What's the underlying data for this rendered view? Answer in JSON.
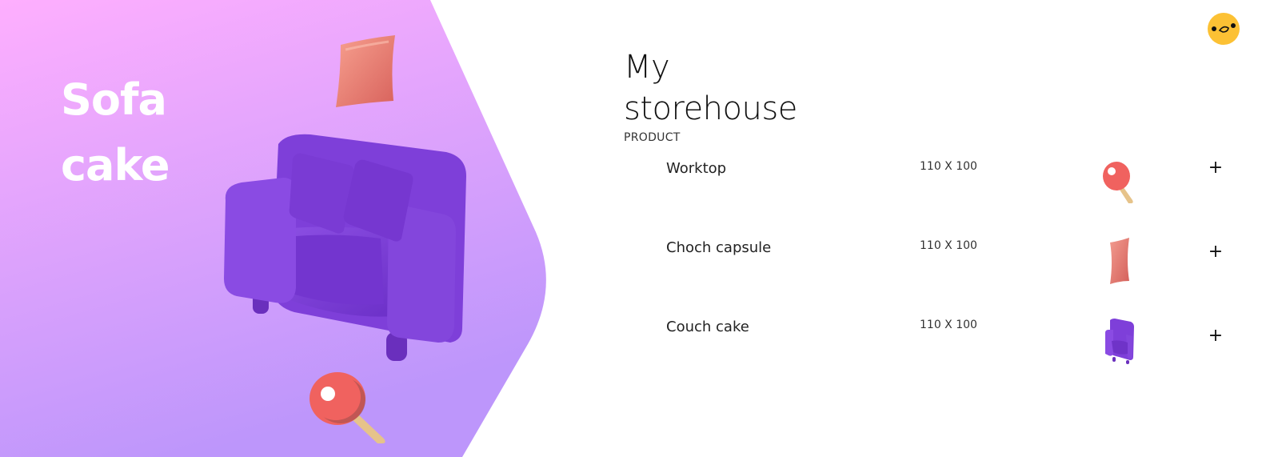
{
  "hero": {
    "title_line1": "Sofa",
    "title_line2": "cake",
    "gradient_top": "#feaffe",
    "gradient_bottom": "#bd96fb"
  },
  "header": {
    "title_line1": "My",
    "title_line2": "storehouse",
    "section_label": "PRODUCT"
  },
  "products": [
    {
      "name": "Worktop",
      "size": "110 X 100",
      "thumb_icon": "ping-pong-paddle-icon",
      "add_label": "+"
    },
    {
      "name": "Choch capsule",
      "size": "110 X 100",
      "thumb_icon": "pillow-icon",
      "add_label": "+"
    },
    {
      "name": "Couch cake",
      "size": "110 X 100",
      "thumb_icon": "armchair-icon",
      "add_label": "+"
    }
  ],
  "avatar": {
    "icon": "avatar-face-icon",
    "color": "#fcc134"
  },
  "colors": {
    "sofa": "#7e3fd9",
    "pillow": "#e88379",
    "paddle": "#f0625f"
  }
}
